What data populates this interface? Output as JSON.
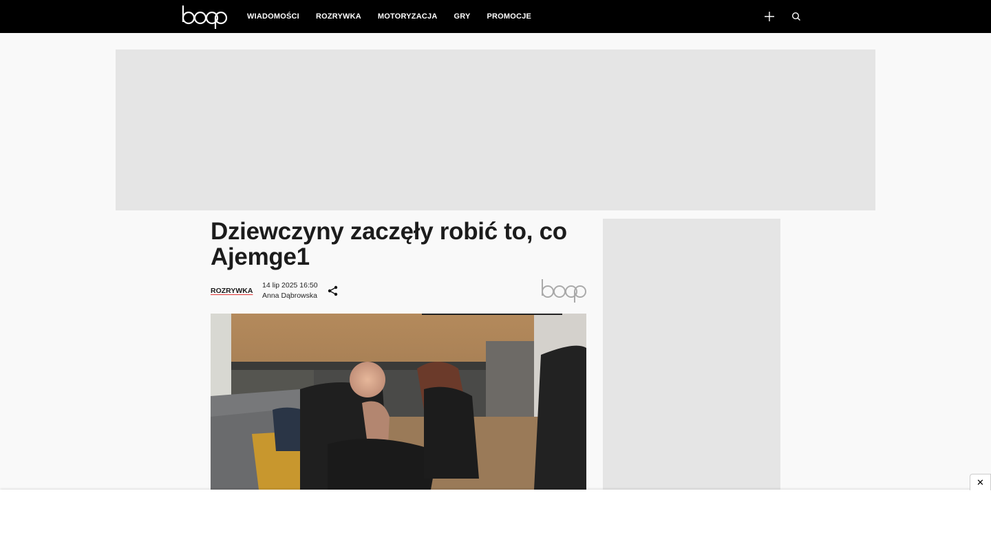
{
  "brand": {
    "logo_text": "boop"
  },
  "nav": {
    "items": [
      "WIADOMOŚCI",
      "ROZRYWKA",
      "MOTORYZACJA",
      "GRY",
      "PROMOCJE"
    ]
  },
  "header_icons": {
    "plus": "plus-icon",
    "search": "search-icon"
  },
  "article": {
    "title": "Dziewczyny zaczęły robić to, co Ajemge1",
    "category": "ROZRYWKA",
    "date": "14 lip 2025 16:50",
    "author": "Anna Dąbrowska",
    "share_icon": "share-icon"
  },
  "bottom_ad": {
    "close_label": "✕"
  },
  "colors": {
    "topbar": "#000000",
    "accent": "#d33333",
    "ad_placeholder": "#e5e5e5"
  }
}
